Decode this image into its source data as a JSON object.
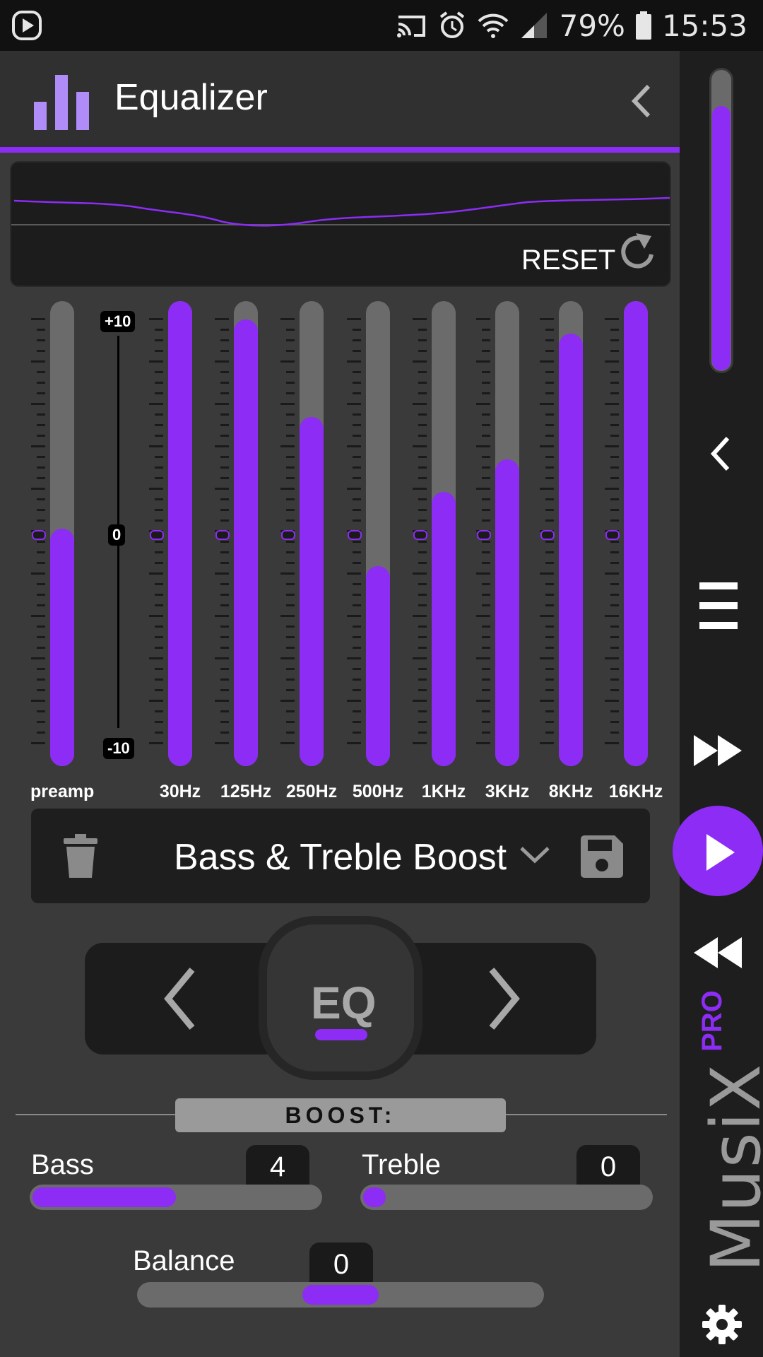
{
  "status_bar": {
    "battery": "79%",
    "time": "15:53"
  },
  "header": {
    "title": "Equalizer"
  },
  "curve": {
    "reset_label": "RESET"
  },
  "scale": {
    "top": "+10",
    "middle": "0",
    "bottom": "-10"
  },
  "bands": [
    {
      "label": "preamp",
      "level": 0.51
    },
    {
      "label": "30Hz",
      "level": 1.0
    },
    {
      "label": "125Hz",
      "level": 0.96
    },
    {
      "label": "250Hz",
      "level": 0.75
    },
    {
      "label": "500Hz",
      "level": 0.43
    },
    {
      "label": "1KHz",
      "level": 0.59
    },
    {
      "label": "3KHz",
      "level": 0.66
    },
    {
      "label": "8KHz",
      "level": 0.93
    },
    {
      "label": "16KHz",
      "level": 1.0
    }
  ],
  "preset": {
    "name": "Bass & Treble Boost"
  },
  "nav": {
    "center_label": "EQ"
  },
  "boost": {
    "title": "BOOST:",
    "bass": {
      "label": "Bass",
      "value": "4",
      "level": 0.5
    },
    "treble": {
      "label": "Treble",
      "value": "0",
      "level": 0.08
    }
  },
  "balance": {
    "label": "Balance",
    "value": "0",
    "position": 0.5
  },
  "volume": {
    "level": 0.9
  },
  "brand": {
    "name": "MusiX",
    "edition": "PRO"
  },
  "colors": {
    "accent": "#8c2cf5",
    "background": "#3a3a3a",
    "panel": "#1c1c1c"
  }
}
